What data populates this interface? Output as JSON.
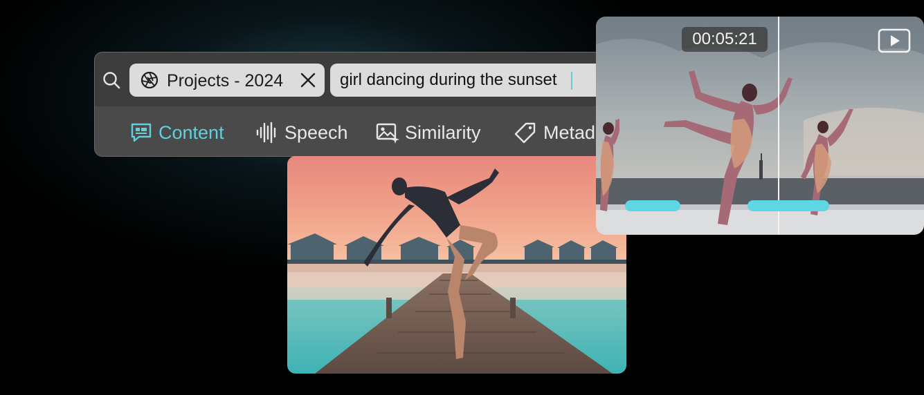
{
  "search": {
    "scope_chip": {
      "label": "Projects - 2024",
      "icon": "aperture-icon",
      "close_icon": "close-icon"
    },
    "query_value": "girl dancing during the sunset"
  },
  "search_modes": [
    {
      "label": "Content",
      "icon": "chat-bubble-icon",
      "active": true
    },
    {
      "label": "Speech",
      "icon": "waveform-icon",
      "active": false
    },
    {
      "label": "Similarity",
      "icon": "image-sparkle-icon",
      "active": false
    },
    {
      "label": "Metad",
      "icon": "tag-icon",
      "active": false
    }
  ],
  "video_preview": {
    "timestamp": "00:05:21",
    "play_icon": "play-icon",
    "match_color": "#5ed6e3"
  },
  "colors": {
    "accent": "#5fd0dc",
    "panel": "#4a4a4a"
  }
}
